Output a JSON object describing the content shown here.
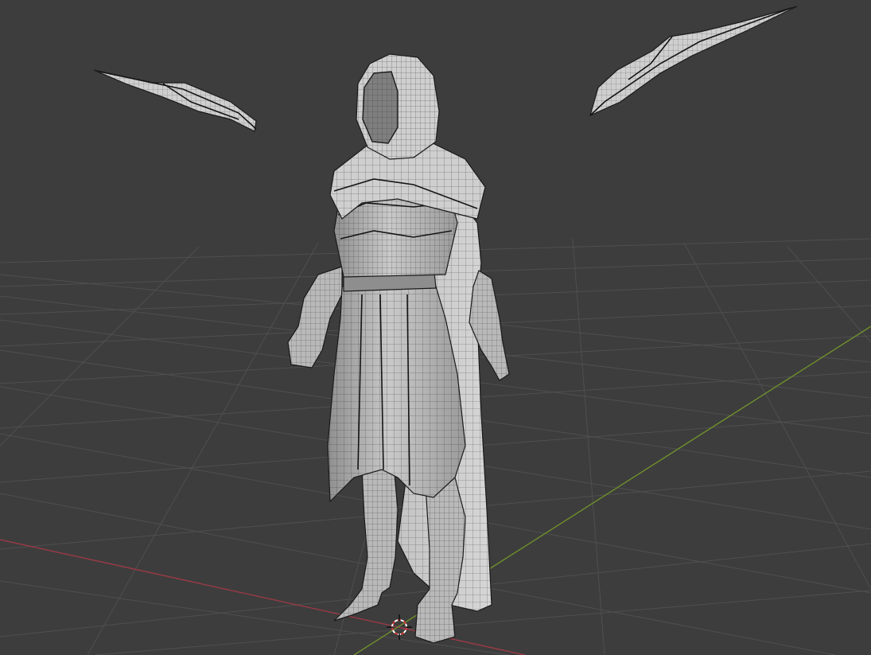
{
  "scene": {
    "background_color": "#3d3d3d",
    "grid_color": "#4f4f4f",
    "x_axis_color": "#9a3a46",
    "y_axis_color": "#6f8f2c",
    "mesh_color": "#b9b9b9",
    "wire_color": "#2a2a2a",
    "shading": "solid-wireframe-overlay",
    "objects": [
      "hooded-armored-character",
      "left-blade",
      "right-blade"
    ],
    "cursor_icon": "3d-cursor-icon"
  }
}
